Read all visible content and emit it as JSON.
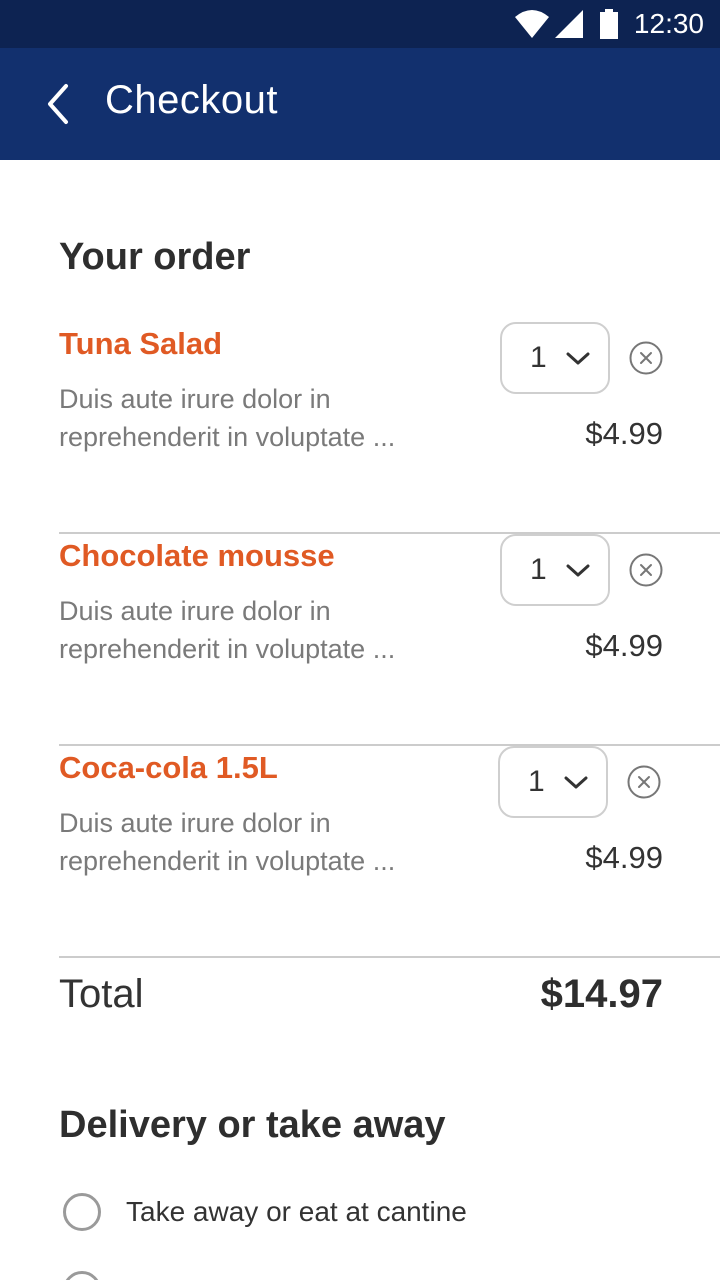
{
  "status_bar": {
    "time": "12:30",
    "icons": [
      "wifi-icon",
      "cell-signal-icon",
      "battery-icon"
    ]
  },
  "app_bar": {
    "title": "Checkout",
    "back_icon": "chevron-left-icon"
  },
  "order": {
    "heading": "Your order",
    "items": [
      {
        "name": "Tuna Salad",
        "desc_line1": "Duis aute irure dolor in",
        "desc_line2": "reprehenderit in voluptate ...",
        "quantity": "1",
        "price": "$4.99"
      },
      {
        "name": "Chocolate mousse",
        "desc_line1": "Duis aute irure dolor in",
        "desc_line2": "reprehenderit in voluptate ...",
        "quantity": "1",
        "price": "$4.99"
      },
      {
        "name": "Coca-cola 1.5L",
        "desc_line1": "Duis aute irure dolor in",
        "desc_line2": "reprehenderit in voluptate ...",
        "quantity": "1",
        "price": "$4.99"
      }
    ],
    "total_label": "Total",
    "total_value": "$14.97"
  },
  "delivery": {
    "heading": "Delivery or take away",
    "options": [
      {
        "label": "Take away or eat at cantine",
        "selected": false
      }
    ]
  },
  "colors": {
    "status_bar": "#0d2352",
    "app_bar": "#12306e",
    "item_name": "#e05a24",
    "divider": "#cccccc"
  }
}
